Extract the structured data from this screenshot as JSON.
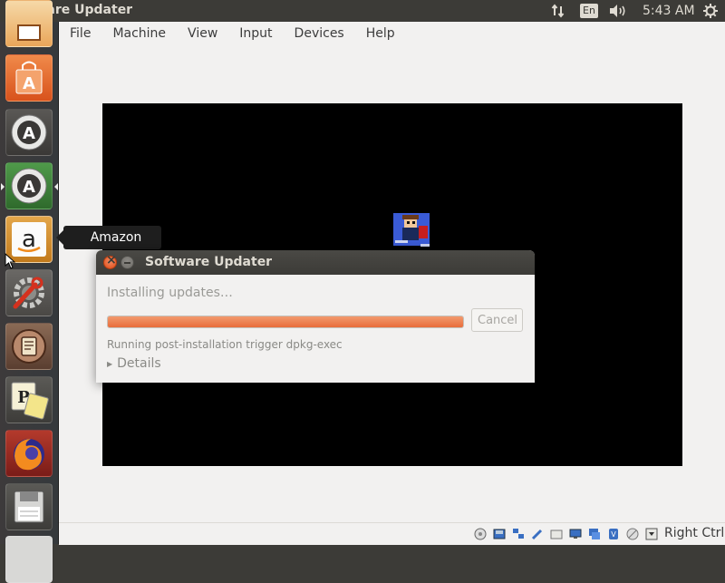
{
  "top_panel": {
    "title": "Software Updater",
    "keyboard_layout": "En",
    "clock": "5:43 AM",
    "icons": [
      "network-updown-icon",
      "volume-icon",
      "session-gear-icon"
    ]
  },
  "launcher": {
    "items": [
      {
        "name": "presentation-app",
        "icon": "presentation-icon"
      },
      {
        "name": "ubuntu-software",
        "icon": "shopping-bag-icon"
      },
      {
        "name": "software-updater",
        "icon": "update-arrows-icon"
      },
      {
        "name": "software-updater-running",
        "icon": "update-arrows-icon",
        "active": true
      },
      {
        "name": "amazon",
        "icon": "amazon-icon",
        "tooltip": "Amazon"
      },
      {
        "name": "system-settings",
        "icon": "settings-wrench-icon"
      },
      {
        "name": "scroll-app",
        "icon": "scroll-icon"
      },
      {
        "name": "solitaire-cards",
        "icon": "playing-cards-icon"
      },
      {
        "name": "firefox",
        "icon": "firefox-icon"
      },
      {
        "name": "floppy-app",
        "icon": "floppy-disk-icon"
      }
    ]
  },
  "vbox": {
    "menu": [
      "File",
      "Machine",
      "View",
      "Input",
      "Devices",
      "Help"
    ],
    "host_key": "Right Ctrl"
  },
  "tooltip": {
    "label": "Amazon"
  },
  "dialog": {
    "title": "Software Updater",
    "heading": "Installing updates…",
    "progress_fraction": 1.0,
    "cancel_label": "Cancel",
    "status": "Running post-installation trigger dpkg-exec",
    "details_label": "Details"
  },
  "colors": {
    "panel": "#3c3b37",
    "progress": "#e86d3b",
    "guest_screen": "#000000"
  }
}
